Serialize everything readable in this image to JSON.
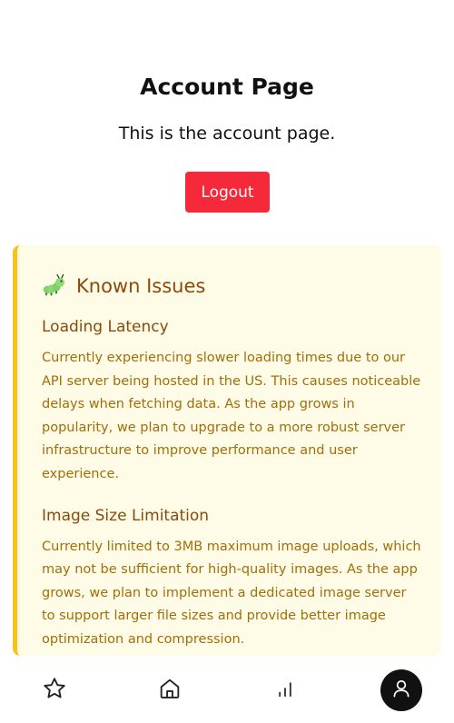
{
  "page": {
    "title": "Account Page",
    "subtitle": "This is the account page.",
    "logout_label": "Logout"
  },
  "known_issues": {
    "title": "Known Issues",
    "icon": "caterpillar-bug-icon",
    "issues": [
      {
        "heading": "Loading Latency",
        "description": "Currently experiencing slower loading times due to our API server being hosted in the US. This causes noticeable delays when fetching data. As the app grows in popularity, we plan to upgrade to a more robust server infrastructure to improve performance and user experience."
      },
      {
        "heading": "Image Size Limitation",
        "description": "Currently limited to 3MB maximum image uploads, which may not be sufficient for high-quality images. As the app grows, we plan to implement a dedicated image server to support larger file sizes and provide better image optimization and compression."
      }
    ]
  },
  "bottom_nav": {
    "items": [
      {
        "icon": "star-icon",
        "active": false
      },
      {
        "icon": "home-icon",
        "active": false
      },
      {
        "icon": "bar-chart-icon",
        "active": false
      },
      {
        "icon": "user-icon",
        "active": true
      }
    ]
  },
  "colors": {
    "logout_button": "#f5293a",
    "card_background": "#fefbe6",
    "card_accent": "#f8c318",
    "issue_title": "#8a4a0c",
    "issue_text": "#a16e0a",
    "nav_active": "#111111"
  }
}
